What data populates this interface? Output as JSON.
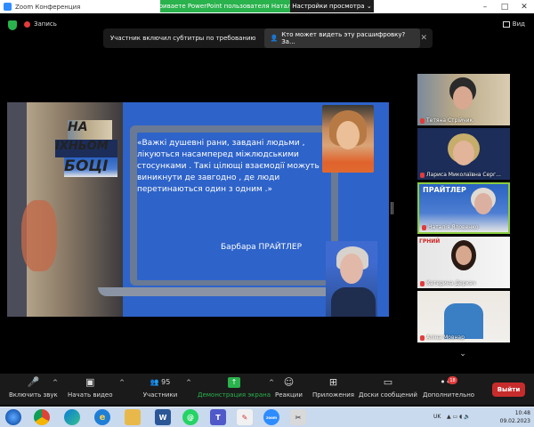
{
  "window": {
    "title": "Zoom Конференция",
    "controls": [
      "–",
      "□",
      "✕"
    ]
  },
  "share_banner": {
    "message": "Вы просматриваете PowerPoint пользователя Наталія Яловенко",
    "options_label": "Настройки просмотра",
    "options_caret": "⌄"
  },
  "status": {
    "recording_label": "Запись",
    "view_label": "Вид"
  },
  "caption_popup": {
    "text": "Участник включил субтитры по требованию",
    "button_label": "Кто может видеть эту расшифровку? За...",
    "close": "✕"
  },
  "slide": {
    "book_title_line1": "НА",
    "book_title_line2": "ІХНЬОМ",
    "book_title_line3": "БОЦІ",
    "quote": "«Важкі душевні рани, завдані людьми , лікуються насамперед міжлюдськими стосунками . Такі цілющі взаємодії  можуть виникнути де завгодно , де люди перетинаються один з одним .»",
    "author": "Барбара ПРАЙТЛЕР"
  },
  "participants": [
    {
      "name": "Тетяна Стрійчик",
      "muted": true
    },
    {
      "name": "Лариса Миколаївна Серг...",
      "muted": true
    },
    {
      "name": "Наталія Яловенко",
      "muted": true,
      "active": true,
      "banner": "ПРАЙТЛЕР"
    },
    {
      "name": "Катерина Деркач",
      "muted": true,
      "banner": "ГРНИЙ"
    },
    {
      "name": "Аліна Мовнар",
      "muted": true
    }
  ],
  "participants_scroll": "⌄",
  "toolbar": {
    "unmute": "Включить звук",
    "start_video": "Начать видео",
    "participants": "Участники",
    "participants_count": "95",
    "share_screen": "Демонстрация экрана",
    "reactions": "Реакции",
    "apps": "Приложения",
    "whiteboards": "Доски сообщений",
    "more": "Дополнительно",
    "more_badge": "18",
    "leave": "Выйти"
  },
  "taskbar": {
    "language": "UK",
    "time": "10:48",
    "date": "09.02.2023",
    "apps": [
      "chrome",
      "edge",
      "ie",
      "explorer",
      "word",
      "whatsapp",
      "teams",
      "paint",
      "zoom",
      "snipping"
    ]
  }
}
